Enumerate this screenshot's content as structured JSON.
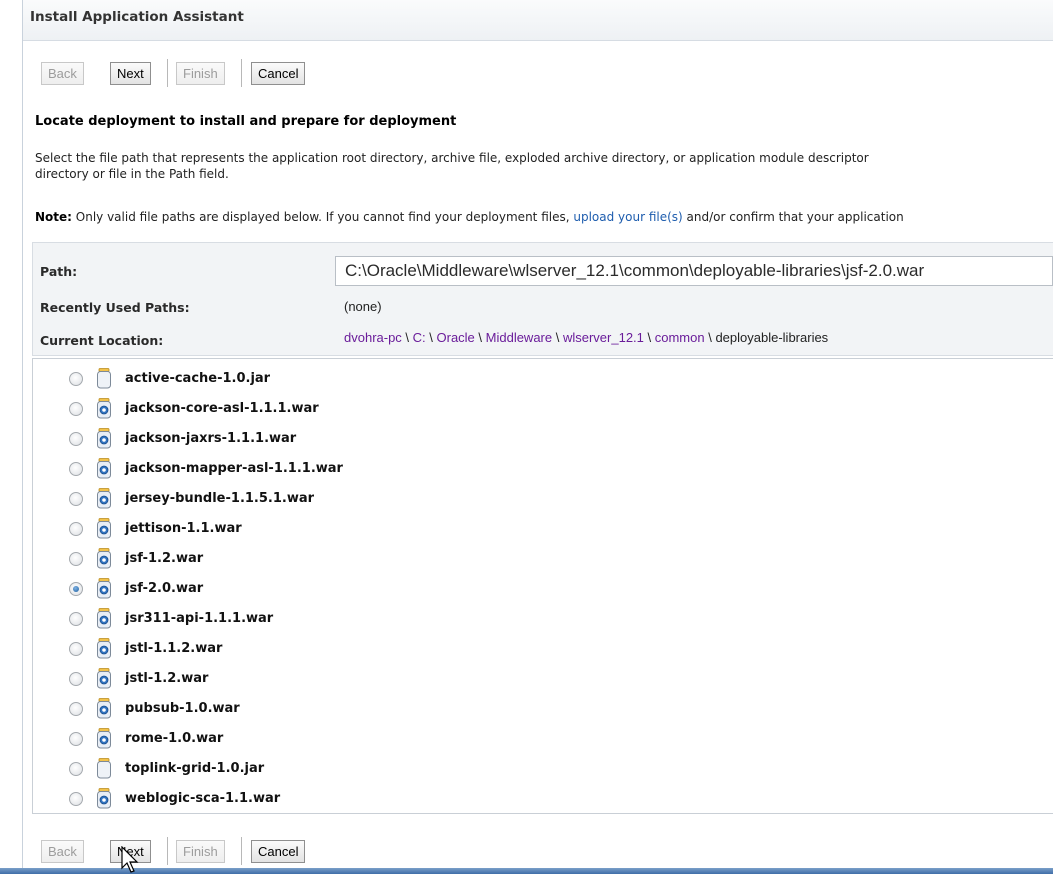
{
  "window": {
    "title": "Install Application Assistant"
  },
  "toolbar_top": {
    "back": "Back",
    "next": "Next",
    "finish": "Finish",
    "cancel": "Cancel"
  },
  "toolbar_bottom": {
    "back": "Back",
    "next": "Next",
    "finish": "Finish",
    "cancel": "Cancel"
  },
  "heading": "Locate deployment to install and prepare for deployment",
  "description": {
    "line1": "Select the file path that represents the application root directory, archive file, exploded archive directory, or application module descriptor",
    "line2": "directory or file in the Path field."
  },
  "note": {
    "label": "Note:",
    "text_before": " Only valid file paths are displayed below. If you cannot find your deployment files, ",
    "link": "upload your file(s)",
    "text_after": " and/or confirm that your application"
  },
  "info": {
    "path_label": "Path:",
    "path_value": "C:\\Oracle\\Middleware\\wlserver_12.1\\common\\deployable-libraries\\jsf-2.0.war",
    "recent_label": "Recently Used Paths:",
    "recent_value": "(none)",
    "location_label": "Current Location:",
    "location_crumbs": [
      "dvohra-pc",
      "C:",
      "Oracle",
      "Middleware",
      "wlserver_12.1",
      "common"
    ],
    "location_current": "deployable-libraries"
  },
  "files": [
    {
      "name": "active-cache-1.0.jar",
      "type": "jar",
      "selected": false
    },
    {
      "name": "jackson-core-asl-1.1.1.war",
      "type": "war",
      "selected": false
    },
    {
      "name": "jackson-jaxrs-1.1.1.war",
      "type": "war",
      "selected": false
    },
    {
      "name": "jackson-mapper-asl-1.1.1.war",
      "type": "war",
      "selected": false
    },
    {
      "name": "jersey-bundle-1.1.5.1.war",
      "type": "war",
      "selected": false
    },
    {
      "name": "jettison-1.1.war",
      "type": "war",
      "selected": false
    },
    {
      "name": "jsf-1.2.war",
      "type": "war",
      "selected": false
    },
    {
      "name": "jsf-2.0.war",
      "type": "war",
      "selected": true
    },
    {
      "name": "jsr311-api-1.1.1.war",
      "type": "war",
      "selected": false
    },
    {
      "name": "jstl-1.1.2.war",
      "type": "war",
      "selected": false
    },
    {
      "name": "jstl-1.2.war",
      "type": "war",
      "selected": false
    },
    {
      "name": "pubsub-1.0.war",
      "type": "war",
      "selected": false
    },
    {
      "name": "rome-1.0.war",
      "type": "war",
      "selected": false
    },
    {
      "name": "toplink-grid-1.0.jar",
      "type": "jar",
      "selected": false
    },
    {
      "name": "weblogic-sca-1.1.war",
      "type": "war",
      "selected": false
    }
  ],
  "colors": {
    "link": "#1e5dae",
    "crumb": "#6a1c9a",
    "radio_checked": "#1d5f9f"
  }
}
